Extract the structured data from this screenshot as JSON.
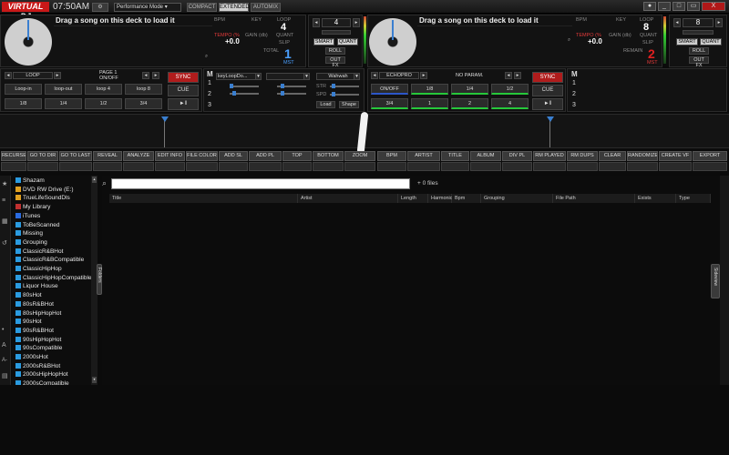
{
  "app": {
    "logo": "VIRTUAL DJ",
    "time": "07:50AM",
    "mode": "Performance Mode",
    "layouts": [
      "COMPACT",
      "EXTENDED",
      "AUTOMIX"
    ],
    "window_buttons": [
      "_",
      "□",
      "X"
    ]
  },
  "deck_left": {
    "title": "Drag a song on this deck to load it",
    "bpm_label": "BPM",
    "key_label": "KEY",
    "loop_label": "LOOP",
    "loop_value": "4",
    "tempo_label": "TEMPO (%",
    "gain_label": "GAIN (db)",
    "quant_label": "QUANT",
    "tempo_value": "+0.0",
    "slip_label": "SLIP",
    "total_label": "TOTAL",
    "deck_number": "1",
    "mst_label": "MST",
    "loop_name": "LOOP",
    "page_label": "PAGE 1",
    "onoff_label": "ON/OFF",
    "sync_label": "SYNC",
    "cue_label": "CUE",
    "play_label": "►‖",
    "pad_row1": [
      "Loop-in",
      "loop-out",
      "loop 4",
      "loop 8"
    ],
    "pad_row2": [
      "1/8",
      "1/4",
      "1/2",
      "3/4"
    ]
  },
  "center_left": {
    "loop_value": "4",
    "smart_label": "SMART",
    "quant_label": "QUANT",
    "roll_label": "ROLL",
    "outfx_label": "OUT FX"
  },
  "mixer": {
    "m_label": "M",
    "rows": [
      "1",
      "2",
      "3"
    ],
    "fx1": "keyLoopDo...",
    "fx2": "",
    "fx3": "Wahwah",
    "str_label": "STR",
    "spd_label": "SPD",
    "load_label": "Load",
    "shape_label": "Shape"
  },
  "deck_right": {
    "title": "Drag a song on this deck to load it",
    "bpm_label": "BPM",
    "key_label": "KEY",
    "loop_label": "LOOP",
    "loop_value": "8",
    "tempo_label": "TEMPO (%",
    "gain_label": "GAIN (db)",
    "quant_label": "QUANT",
    "tempo_value": "+0.0",
    "slip_label": "SLIP",
    "remain_label": "REMAIN",
    "deck_number": "2",
    "mst_label": "MST",
    "fx_name": "ECHOPRO",
    "noparam_label": "NO PARAM.",
    "sync_label": "SYNC",
    "cue_label": "CUE",
    "play_label": "►‖",
    "pad_row1": [
      "ON/OFF",
      "1/8",
      "1/4",
      "1/2"
    ],
    "pad_row2": [
      "3/4",
      "1",
      "2",
      "4"
    ],
    "m_label": "M",
    "rows": [
      "1",
      "2",
      "3"
    ]
  },
  "center_right": {
    "loop_value": "8",
    "smart_label": "SMART",
    "quant_label": "QUANT",
    "roll_label": "ROLL",
    "outfx_label": "OUT FX"
  },
  "toolbar": {
    "buttons": [
      "RECURSE",
      "GO TO DIR",
      "GO TO LAST",
      "REVEAL",
      "ANALYZE",
      "EDIT INFO",
      "FILE COLOR",
      "ADD SL",
      "ADD PL",
      "TOP",
      "BOTTOM",
      "ZOOM",
      "BPM",
      "ARTIST",
      "TITLE",
      "ALBUM",
      "DIV PL",
      "RM PLAYED",
      "RM DUPS",
      "CLEAR",
      "RANDOMIZE",
      "CREATE VF",
      "EXPORT"
    ]
  },
  "browser": {
    "search_placeholder": "",
    "file_count": "+ 0 files",
    "columns": [
      "Title",
      "Artist",
      "Length",
      "Harmonic",
      "Bpm",
      "Grouping",
      "File Path",
      "Exists",
      "Type"
    ],
    "tree": [
      {
        "label": "Shazam",
        "color": "#2a9be0"
      },
      {
        "label": "DVD RW Drive (E:)",
        "color": "#e0a020"
      },
      {
        "label": "TrueLifeSoundDls",
        "color": "#e0a020"
      },
      {
        "label": "My Library",
        "color": "#c03030"
      },
      {
        "label": "iTunes",
        "color": "#2a6be0"
      },
      {
        "label": "ToBeScanned",
        "color": "#2a9be0"
      },
      {
        "label": "Missing",
        "color": "#2a9be0"
      },
      {
        "label": "Grouping",
        "color": "#2a9be0"
      },
      {
        "label": "ClassicR&BHot",
        "color": "#2a9be0"
      },
      {
        "label": "ClassicR&BCompatible",
        "color": "#2a9be0"
      },
      {
        "label": "ClassicHipHop",
        "color": "#2a9be0"
      },
      {
        "label": "ClassicHipHopCompatible",
        "color": "#2a9be0"
      },
      {
        "label": "Liquor House",
        "color": "#2a9be0"
      },
      {
        "label": "80sHot",
        "color": "#2a9be0"
      },
      {
        "label": "80sR&BHot",
        "color": "#2a9be0"
      },
      {
        "label": "80sHipHopHot",
        "color": "#2a9be0"
      },
      {
        "label": "90sHot",
        "color": "#2a9be0"
      },
      {
        "label": "90sR&BHot",
        "color": "#2a9be0"
      },
      {
        "label": "90sHipHopHot",
        "color": "#2a9be0"
      },
      {
        "label": "90sCompatible",
        "color": "#2a9be0"
      },
      {
        "label": "2000sHot",
        "color": "#2a9be0"
      },
      {
        "label": "2000sR&BHot",
        "color": "#2a9be0"
      },
      {
        "label": "2000sHipHopHot",
        "color": "#2a9be0"
      },
      {
        "label": "2000sCompatible",
        "color": "#2a9be0"
      }
    ],
    "folders_tab": "Folders",
    "sideview_tab": "Sideview"
  }
}
